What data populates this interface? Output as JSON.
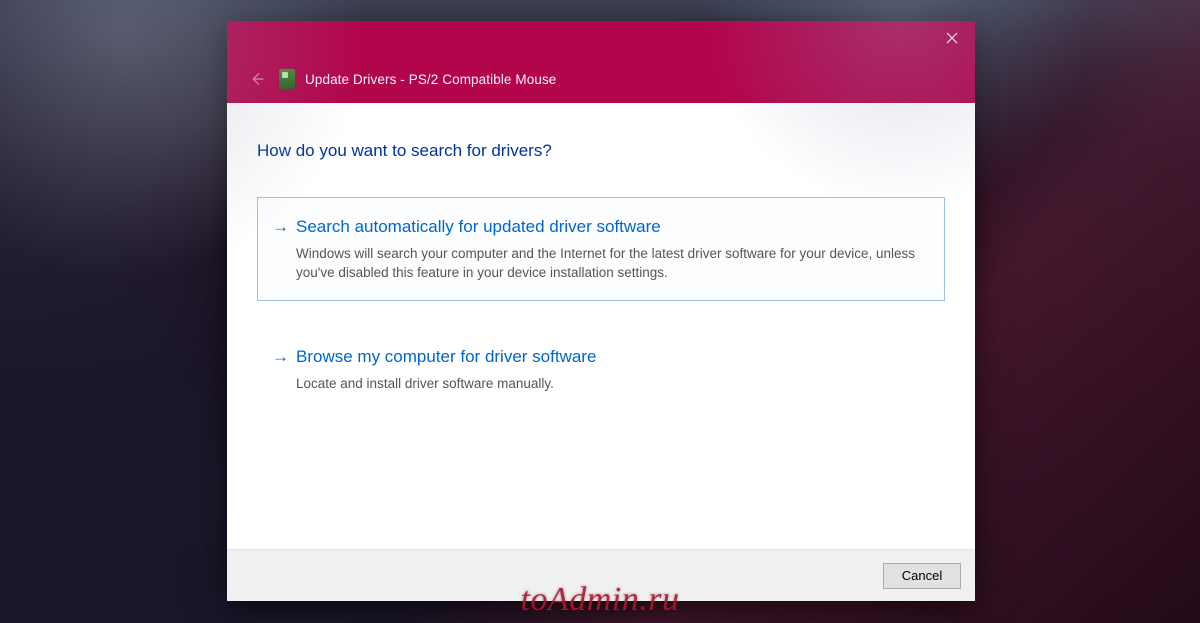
{
  "window": {
    "title": "Update Drivers - PS/2 Compatible Mouse"
  },
  "content": {
    "heading": "How do you want to search for drivers?",
    "options": [
      {
        "title": "Search automatically for updated driver software",
        "description": "Windows will search your computer and the Internet for the latest driver software for your device, unless you've disabled this feature in your device installation settings."
      },
      {
        "title": "Browse my computer for driver software",
        "description": "Locate and install driver software manually."
      }
    ]
  },
  "footer": {
    "cancel_label": "Cancel"
  },
  "watermark": "toAdmin.ru",
  "colors": {
    "accent": "#b2054c",
    "link": "#0066cc"
  }
}
